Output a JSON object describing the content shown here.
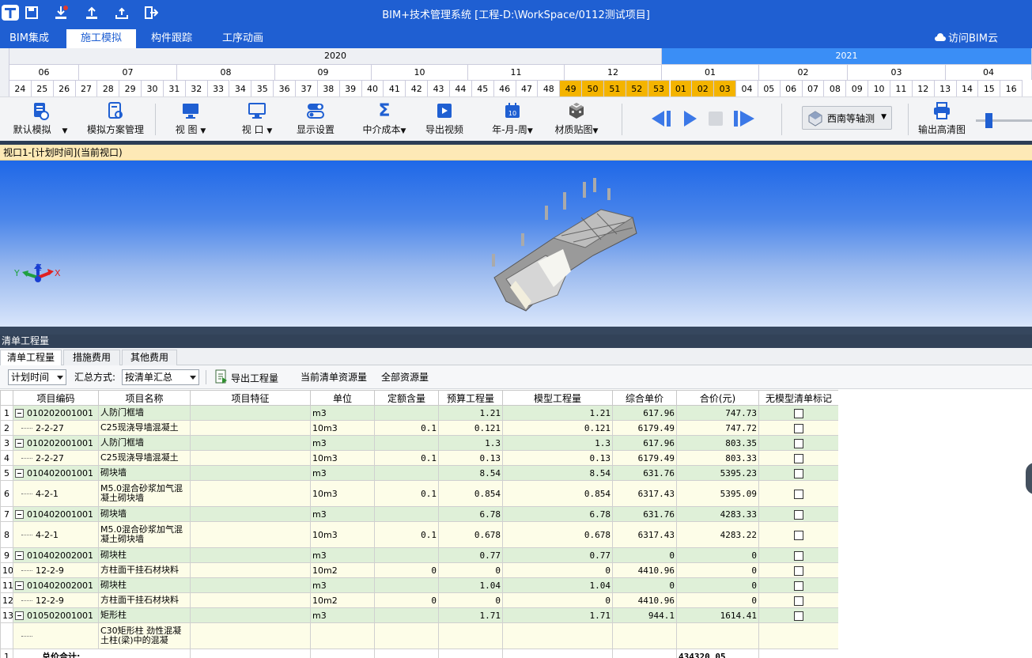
{
  "titlebar": {
    "title": "BIM+技术管理系统 [工程-D:\\WorkSpace/0112测试项目]",
    "icons": [
      "app-logo-icon",
      "save-icon",
      "download-icon",
      "upload-icon",
      "cloud-upload-icon",
      "exit-icon"
    ]
  },
  "menu": {
    "tabs": [
      "BIM集成",
      "施工模拟",
      "构件跟踪",
      "工序动画"
    ],
    "active": 1,
    "cloud": "访问BIM云"
  },
  "timeline": {
    "years": [
      "2020",
      "2021"
    ],
    "months": [
      "06",
      "07",
      "08",
      "09",
      "10",
      "11",
      "12",
      "01",
      "02",
      "03",
      "04"
    ],
    "days": [
      "24",
      "25",
      "26",
      "27",
      "28",
      "29",
      "30",
      "31",
      "32",
      "33",
      "34",
      "35",
      "36",
      "37",
      "38",
      "39",
      "40",
      "41",
      "42",
      "43",
      "44",
      "45",
      "46",
      "47",
      "48",
      "49",
      "50",
      "51",
      "52",
      "53",
      "01",
      "02",
      "03",
      "04",
      "05",
      "06",
      "07",
      "08",
      "09",
      "10",
      "11",
      "12",
      "13",
      "14",
      "15",
      "16"
    ],
    "highlight_from": 25,
    "highlight_to": 32
  },
  "toolbar": {
    "items": [
      "默认模拟",
      "模拟方案管理",
      "视 图",
      "视 口",
      "显示设置",
      "中介成本",
      "导出视频",
      "年-月-周",
      "材质贴图",
      "西南等轴测",
      "输出高清图"
    ]
  },
  "viewport": {
    "title": "视口1-[计划时间](当前视口)",
    "axis": {
      "x": "X",
      "y": "Y",
      "z": "Z"
    }
  },
  "panel": {
    "title": "清单工程量",
    "tabs": [
      "清单工程量",
      "措施费用",
      "其他费用"
    ],
    "active": 0
  },
  "filter": {
    "time_select": "计划时间",
    "summary_label": "汇总方式:",
    "summary_select": "按清单汇总",
    "export": "导出工程量",
    "current_res": "当前清单资源量",
    "all_res": "全部资源量"
  },
  "columns": [
    "项目编码",
    "项目名称",
    "项目特征",
    "单位",
    "定额含量",
    "预算工程量",
    "模型工程量",
    "综合单价",
    "合价(元)",
    "无模型清单标记"
  ],
  "rows": [
    {
      "n": "1",
      "level": 0,
      "code": "010202001001",
      "name": "人防门框墙",
      "unit": "m3",
      "ration": "",
      "budget": "1.21",
      "model": "1.21",
      "price": "617.96",
      "total": "747.73"
    },
    {
      "n": "2",
      "level": 1,
      "code": "2-2-27",
      "name": "C25现浇导墙混凝土",
      "unit": "10m3",
      "ration": "0.1",
      "budget": "0.121",
      "model": "0.121",
      "price": "6179.49",
      "total": "747.72"
    },
    {
      "n": "3",
      "level": 0,
      "code": "010202001001",
      "name": "人防门框墙",
      "unit": "m3",
      "ration": "",
      "budget": "1.3",
      "model": "1.3",
      "price": "617.96",
      "total": "803.35"
    },
    {
      "n": "4",
      "level": 1,
      "code": "2-2-27",
      "name": "C25现浇导墙混凝土",
      "unit": "10m3",
      "ration": "0.1",
      "budget": "0.13",
      "model": "0.13",
      "price": "6179.49",
      "total": "803.33"
    },
    {
      "n": "5",
      "level": 0,
      "code": "010402001001",
      "name": "砌块墙",
      "unit": "m3",
      "ration": "",
      "budget": "8.54",
      "model": "8.54",
      "price": "631.76",
      "total": "5395.23"
    },
    {
      "n": "6",
      "level": 1,
      "code": "4-2-1",
      "name": "M5.0混合砂浆加气混凝土砌块墙",
      "unit": "10m3",
      "ration": "0.1",
      "budget": "0.854",
      "model": "0.854",
      "price": "6317.43",
      "total": "5395.09",
      "tall": true
    },
    {
      "n": "7",
      "level": 0,
      "code": "010402001001",
      "name": "砌块墙",
      "unit": "m3",
      "ration": "",
      "budget": "6.78",
      "model": "6.78",
      "price": "631.76",
      "total": "4283.33"
    },
    {
      "n": "8",
      "level": 1,
      "code": "4-2-1",
      "name": "M5.0混合砂浆加气混凝土砌块墙",
      "unit": "10m3",
      "ration": "0.1",
      "budget": "0.678",
      "model": "0.678",
      "price": "6317.43",
      "total": "4283.22",
      "tall": true
    },
    {
      "n": "9",
      "level": 0,
      "code": "010402002001",
      "name": "砌块柱",
      "unit": "m3",
      "ration": "",
      "budget": "0.77",
      "model": "0.77",
      "price": "0",
      "total": "0"
    },
    {
      "n": "10",
      "level": 1,
      "code": "12-2-9",
      "name": "方柱面干挂石材块料",
      "unit": "10m2",
      "ration": "0",
      "budget": "0",
      "model": "0",
      "price": "4410.96",
      "total": "0"
    },
    {
      "n": "11",
      "level": 0,
      "code": "010402002001",
      "name": "砌块柱",
      "unit": "m3",
      "ration": "",
      "budget": "1.04",
      "model": "1.04",
      "price": "0",
      "total": "0"
    },
    {
      "n": "12",
      "level": 1,
      "code": "12-2-9",
      "name": "方柱面干挂石材块料",
      "unit": "10m2",
      "ration": "0",
      "budget": "0",
      "model": "0",
      "price": "4410.96",
      "total": "0"
    },
    {
      "n": "13",
      "level": 0,
      "code": "010502001001",
      "name": "矩形柱",
      "unit": "m3",
      "ration": "",
      "budget": "1.71",
      "model": "1.71",
      "price": "944.1",
      "total": "1614.41"
    },
    {
      "n": "",
      "level": 1,
      "code": "",
      "name": "C30矩形柱 劲性混凝土柱(梁)中的混凝",
      "unit": "",
      "ration": "",
      "budget": "",
      "model": "",
      "price": "",
      "total": "",
      "tall": true,
      "partial": true
    }
  ],
  "footer": {
    "n": "1",
    "label": "总价合计:",
    "total": "434320.05"
  }
}
